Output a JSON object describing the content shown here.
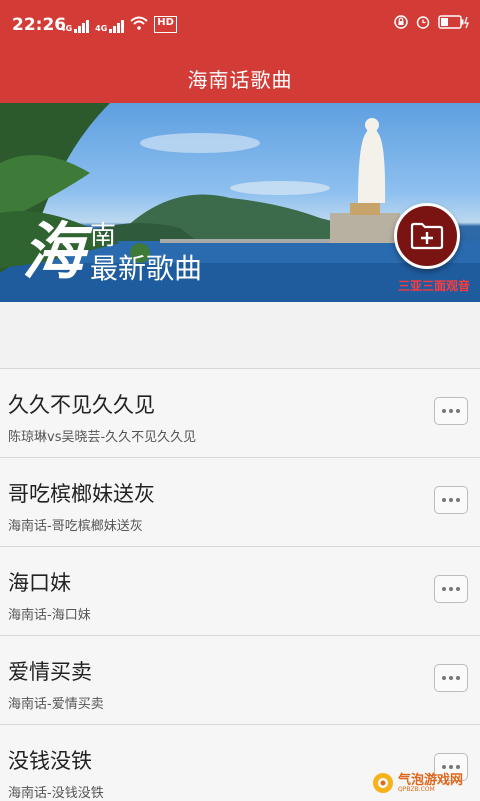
{
  "status_bar": {
    "time": "22:26",
    "network_labels": [
      "4G",
      "4G"
    ],
    "hd_label": "HD"
  },
  "app_bar": {
    "title": "海南话歌曲"
  },
  "banner": {
    "big_char": "海",
    "line1": "南",
    "line2": "最新歌曲",
    "caption": "三亚三面观音"
  },
  "songs": [
    {
      "title": "久久不见久久见",
      "subtitle": "陈琼琳vs吴晓芸-久久不见久久见"
    },
    {
      "title": "哥吃槟榔妹送灰",
      "subtitle": "海南话-哥吃槟榔妹送灰"
    },
    {
      "title": "海口妹",
      "subtitle": "海南话-海口妹"
    },
    {
      "title": "爱情买卖",
      "subtitle": "海南话-爱情买卖"
    },
    {
      "title": "没钱没铁",
      "subtitle": "海南话-没钱没铁"
    }
  ],
  "watermark": {
    "text": "气泡游戏网",
    "sub": "QPBZB.COM"
  },
  "colors": {
    "primary": "#d23b36",
    "fab": "#7a1413"
  }
}
